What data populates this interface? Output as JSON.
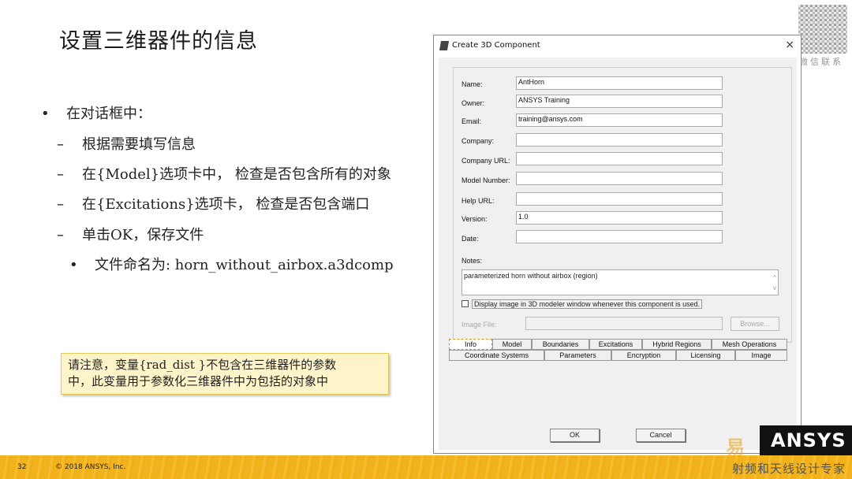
{
  "slide": {
    "title": "设置三维器件的信息",
    "bullets": [
      {
        "mark": "•",
        "text": "在对话框中："
      },
      {
        "mark": "–",
        "text": "根据需要填写信息"
      },
      {
        "mark": "–",
        "text": "在{Model}选项卡中， 检查是否包含所有的对象"
      },
      {
        "mark": "–",
        "text": "在{Excitations}选项卡， 检查是否包含端口"
      },
      {
        "mark": "–",
        "text": "单击OK，保存文件"
      },
      {
        "mark": "•",
        "text": "文件命名为: horn_without_airbox.a3dcomp"
      }
    ],
    "note_line1": "请注意，变量{rad_dist }不包含在三维器件的参数",
    "note_line2": "中，此变量用于参数化三维器件中为包括的对象中",
    "qr_caption": "微信联系",
    "page_number": "32",
    "copyright": "© 2018 ANSYS, Inc.",
    "watermark_text": "射频和天线设计专家",
    "watermark_mark": "易",
    "logo_text": "ANSYS"
  },
  "dialog": {
    "title": "Create 3D Component",
    "close": "×",
    "fields": [
      {
        "label": "Name:",
        "value": "AntHorn"
      },
      {
        "label": "Owner:",
        "value": "ANSYS Training"
      },
      {
        "label": "Email:",
        "value": "training@ansys.com"
      },
      {
        "label": "Company:",
        "value": ""
      },
      {
        "label": "Company URL:",
        "value": ""
      },
      {
        "label": "Model Number:",
        "value": ""
      },
      {
        "label": "Help URL:",
        "value": ""
      },
      {
        "label": "Version:",
        "value": "1.0"
      },
      {
        "label": "Date:",
        "value": ""
      }
    ],
    "notes_label": "Notes:",
    "notes_value": "parameterized horn without airbox (region)",
    "checkbox_label": "Display image in 3D modeler window whenever this component is used.",
    "image_file_label": "Image File:",
    "browse_label": "Browse...",
    "tabs_row1": [
      "Info",
      "Model",
      "Boundaries",
      "Excitations",
      "Hybrid Regions",
      "Mesh Operations"
    ],
    "tabs_row2": [
      "Coordinate Systems",
      "Parameters",
      "Encryption",
      "Licensing",
      "Image"
    ],
    "ok_label": "OK",
    "cancel_label": "Cancel"
  }
}
